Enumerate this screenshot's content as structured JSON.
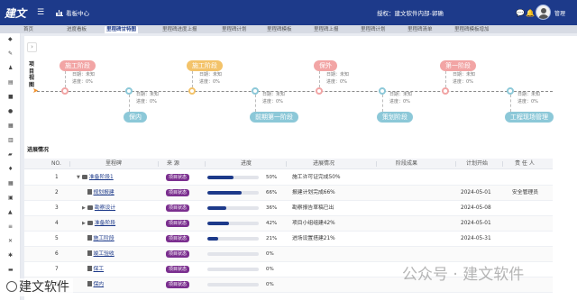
{
  "app": {
    "logo": "建文",
    "nav_title": "看板中心",
    "tenant": "授权：建文软件内部-郭确",
    "user": "管理"
  },
  "tabs": [
    "首页",
    "进度看板",
    "里程碑甘特图",
    "里程碑进度上报",
    "里程碑计划",
    "里程碑模板",
    "里程碑上报",
    "里程碑计划",
    "里程碑清单",
    "里程碑模板增加"
  ],
  "page": {
    "vertical_title": "项目视图",
    "section_title": "进展情况"
  },
  "timeline": {
    "date_label": "日期：未知",
    "progress_label": "进度：",
    "nodes": [
      {
        "name": "施工阶段",
        "progress": "0%",
        "color": "#f2a5a5",
        "position": "top"
      },
      {
        "name": "保内",
        "progress": "0%",
        "color": "#8cc8d8",
        "position": "bottom"
      },
      {
        "name": "施工阶段",
        "progress": "0%",
        "color": "#f3c36a",
        "position": "top"
      },
      {
        "name": "前期第一阶段",
        "progress": "0%",
        "color": "#8cc8d8",
        "position": "bottom"
      },
      {
        "name": "保外",
        "progress": "0%",
        "color": "#f2a5a5",
        "position": "top"
      },
      {
        "name": "策划阶段",
        "progress": "0%",
        "color": "#8cc8d8",
        "position": "bottom"
      },
      {
        "name": "第一阶段",
        "progress": "0%",
        "color": "#f2a5a5",
        "position": "top"
      },
      {
        "name": "工程现场管理",
        "progress": "0%",
        "color": "#8cc8d8",
        "position": "bottom"
      }
    ]
  },
  "table": {
    "columns": [
      "NO.",
      "里程碑",
      "来 源",
      "进度",
      "进展情况",
      "阶段成果",
      "计划开始",
      "责 任 人"
    ],
    "rows": [
      {
        "no": "1",
        "name": "准备阶段1",
        "source": "项目状态",
        "progress": 50,
        "progress_text": "50%",
        "status": "施工许可证完成50%",
        "result": "",
        "start": "",
        "owner": ""
      },
      {
        "no": "2",
        "name": "规划报建",
        "source": "项目状态",
        "progress": 66,
        "progress_text": "66%",
        "status": "报建计划完成66%",
        "result": "",
        "start": "2024-05-01",
        "owner": "安全管理员"
      },
      {
        "no": "3",
        "name": "勘察设计",
        "source": "项目状态",
        "progress": 36,
        "progress_text": "36%",
        "status": "勘察报告草稿已出",
        "result": "",
        "start": "2024-05-08",
        "owner": ""
      },
      {
        "no": "4",
        "name": "准备阶段",
        "source": "项目状态",
        "progress": 42,
        "progress_text": "42%",
        "status": "项目小组组建42%",
        "result": "",
        "start": "2024-05-01",
        "owner": ""
      },
      {
        "no": "5",
        "name": "施工阶段",
        "source": "项目状态",
        "progress": 21,
        "progress_text": "21%",
        "status": "进场设置搭建21%",
        "result": "",
        "start": "2024-05-31",
        "owner": ""
      },
      {
        "no": "6",
        "name": "竣工验收",
        "source": "项目状态",
        "progress": 0,
        "progress_text": "0%",
        "status": "",
        "result": "",
        "start": "",
        "owner": ""
      },
      {
        "no": "7",
        "name": "保工",
        "source": "项目状态",
        "progress": 0,
        "progress_text": "0%",
        "status": "",
        "result": "",
        "start": "",
        "owner": ""
      },
      {
        "no": "8",
        "name": "保内",
        "source": "项目状态",
        "progress": 0,
        "progress_text": "0%",
        "status": "",
        "result": "",
        "start": "",
        "owner": ""
      }
    ]
  },
  "watermark": {
    "left": "建文软件",
    "right": "公众号 · 建文软件"
  }
}
